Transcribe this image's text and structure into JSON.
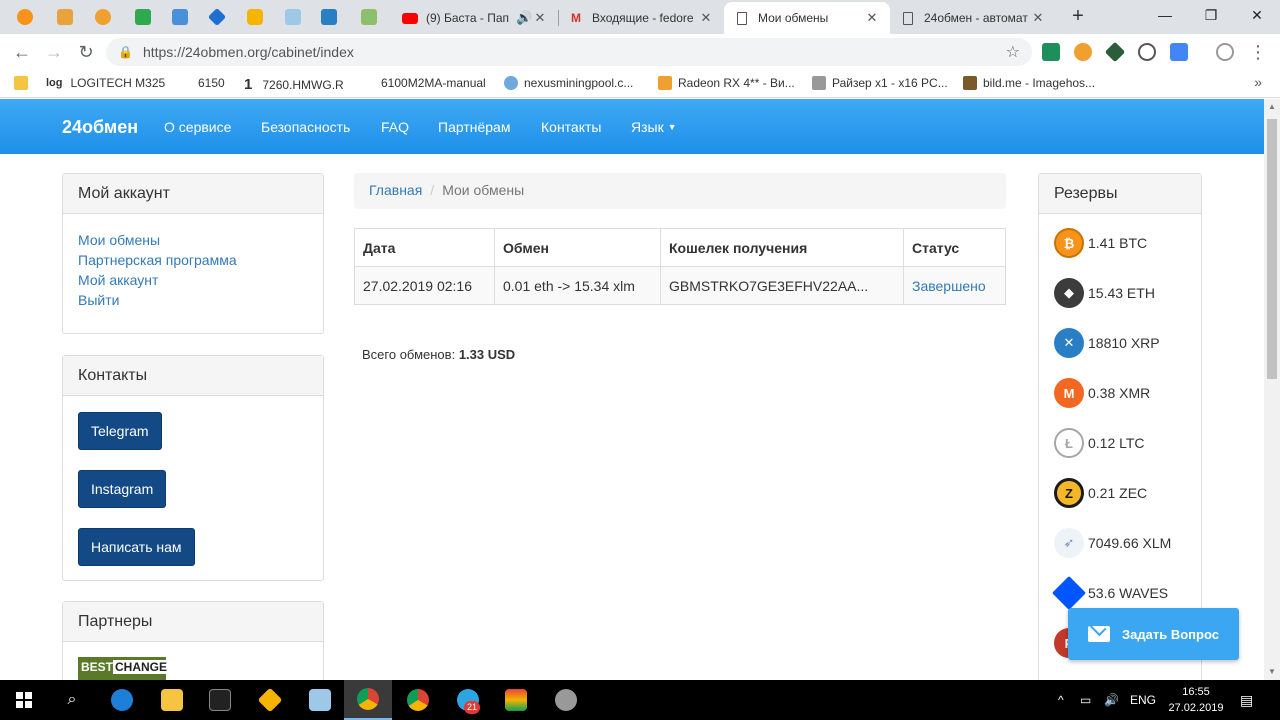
{
  "browser": {
    "tabs": [
      {
        "title": "(9) Баста - Пап",
        "icon": "youtube-icon"
      },
      {
        "title": "Входящие - fedore",
        "icon": "gmail-icon"
      },
      {
        "title": "Мои обмены",
        "icon": "page-icon"
      },
      {
        "title": "24обмен - автомат",
        "icon": "page-icon"
      }
    ],
    "new_tab": "+",
    "url": "https://24obmen.org/cabinet/index"
  },
  "bookmarks": [
    {
      "label": "LOGITECH M325",
      "prefix": "log"
    },
    {
      "label": "6150"
    },
    {
      "label": "7260.HMWG.R",
      "prefix": "1"
    },
    {
      "label": "6100M2MA-manual"
    },
    {
      "label": "nexusminingpool.c..."
    },
    {
      "label": "Radeon RX 4** - Ви..."
    },
    {
      "label": "Райзер x1 - x16 PC..."
    },
    {
      "label": "bild.me - Imagehos..."
    }
  ],
  "site": {
    "brand": "24обмен",
    "nav": [
      "О сервисе",
      "Безопасность",
      "FAQ",
      "Партнёрам",
      "Контакты",
      "Язык"
    ]
  },
  "account": {
    "title": "Мой аккаунт",
    "links": [
      "Мои обмены",
      "Партнерская программа",
      "Мой аккаунт",
      "Выйти"
    ]
  },
  "contacts": {
    "title": "Контакты",
    "buttons": [
      "Telegram",
      "Instagram",
      "Написать нам"
    ]
  },
  "partners": {
    "title": "Партнеры",
    "logo": [
      "BEST",
      "CHANGE"
    ]
  },
  "breadcrumb": {
    "home": "Главная",
    "separator": "/",
    "current": "Мои обмены"
  },
  "exchanges": {
    "headers": [
      "Дата",
      "Обмен",
      "Кошелек получения",
      "Статус"
    ],
    "rows": [
      [
        "27.02.2019 02:16",
        "0.01 eth -> 15.34 xlm",
        "GBMSTRKO7GE3EFHV22AA...",
        "Завершено"
      ]
    ]
  },
  "total": {
    "label": "Всего обменов:",
    "value": "1.33 USD"
  },
  "reserves": {
    "title": "Резервы",
    "items": [
      {
        "amount": "1.41 BTC",
        "icon": "bitcoin-icon",
        "color": "#f7931a"
      },
      {
        "amount": "15.43 ETH",
        "icon": "ethereum-icon",
        "color": "#3c3c3d"
      },
      {
        "amount": "18810 XRP",
        "icon": "ripple-icon",
        "color": "#2a7fc4"
      },
      {
        "amount": "0.38 XMR",
        "icon": "monero-icon",
        "color": "#f26822"
      },
      {
        "amount": "0.12 LTC",
        "icon": "litecoin-icon",
        "color": "#a6a6a6"
      },
      {
        "amount": "0.21 ZEC",
        "icon": "zcash-icon",
        "color": "#1a1a1a"
      },
      {
        "amount": "7049.66 XLM",
        "icon": "stellar-icon",
        "color": "#6c8ebf"
      },
      {
        "amount": "53.6 WAVES",
        "icon": "waves-icon",
        "color": "#0055ff"
      }
    ]
  },
  "ask_button": "Задать Вопрос",
  "taskbar": {
    "lang": "ENG",
    "time": "16:55",
    "date": "27.02.2019",
    "telegram_badge": "21"
  }
}
